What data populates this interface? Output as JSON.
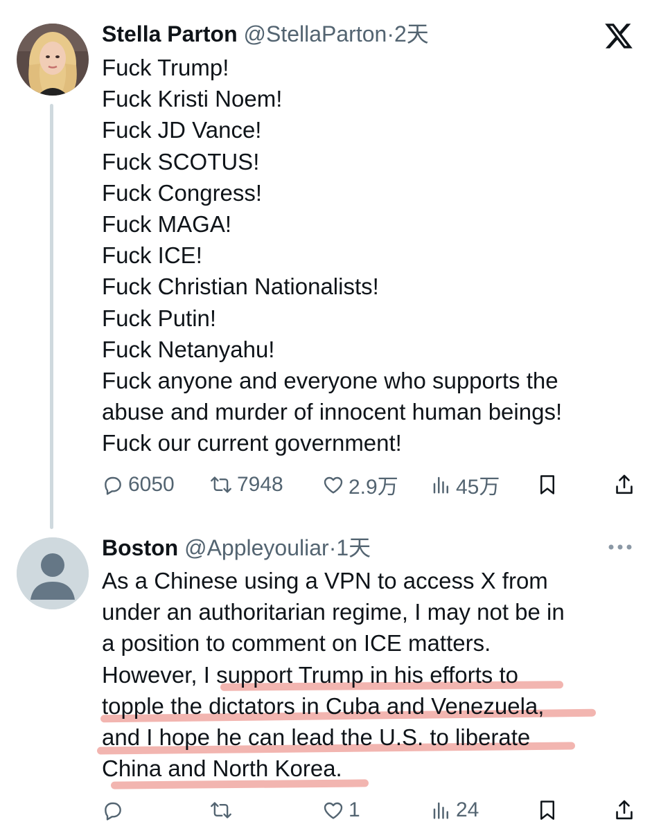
{
  "tweet1": {
    "display_name": "Stella Parton",
    "handle": "@StellaParton",
    "separator": "·",
    "time": "2天",
    "body": "Fuck Trump!\nFuck Kristi Noem!\nFuck JD Vance!\nFuck SCOTUS!\nFuck Congress!\nFuck MAGA!\nFuck ICE!\nFuck Christian Nationalists!\nFuck Putin!\nFuck Netanyahu!\nFuck anyone and everyone who supports the\nabuse and murder of innocent human beings!\nFuck our current government!",
    "replies": "6050",
    "reposts": "7948",
    "likes": "2.9万",
    "views": "45万"
  },
  "tweet2": {
    "display_name": "Boston",
    "handle": "@Appleyouliar",
    "separator": "·",
    "time": "1天",
    "body": "As a Chinese using a VPN to access X from\nunder an authoritarian regime, I may not be in\na position to comment on ICE matters.\nHowever, I support Trump in his efforts to\ntopple the dictators in Cuba and Venezuela,\nand I hope he can lead the U.S. to liberate\nChina and North Korea.",
    "replies": "",
    "reposts": "",
    "likes": "1",
    "views": "24"
  },
  "icons": {
    "brand": "x-logo-icon",
    "reply": "reply-icon",
    "repost": "repost-icon",
    "like": "heart-icon",
    "views": "views-icon",
    "bookmark": "bookmark-icon",
    "share": "share-icon",
    "more": "more-icon"
  },
  "colors": {
    "text_primary": "#0f1419",
    "text_secondary": "#536471",
    "thread_line": "#cfd9de",
    "highlight": "#e87870"
  }
}
